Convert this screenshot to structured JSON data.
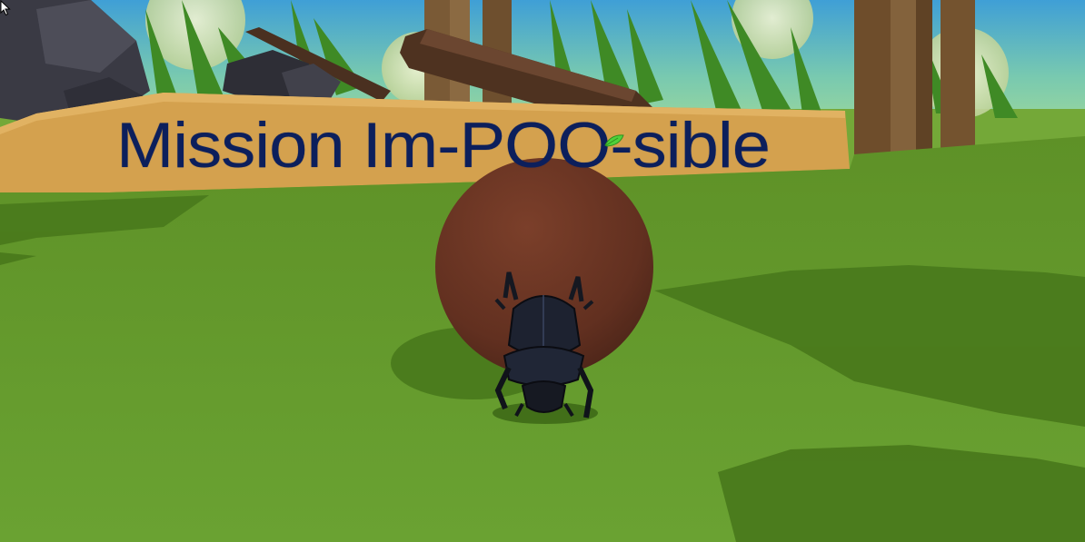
{
  "game": {
    "title": "Mission Im-POO-sible",
    "title_color": "#0c1f5c",
    "title_banner_color": "#d4a14e",
    "ground_color": "#6a9a2e",
    "dung_ball_color": "#6b3522",
    "beetle_color": "#1a1d27",
    "leaf_icon": "leaf-icon",
    "cursor_icon": "mouse-pointer-icon"
  }
}
